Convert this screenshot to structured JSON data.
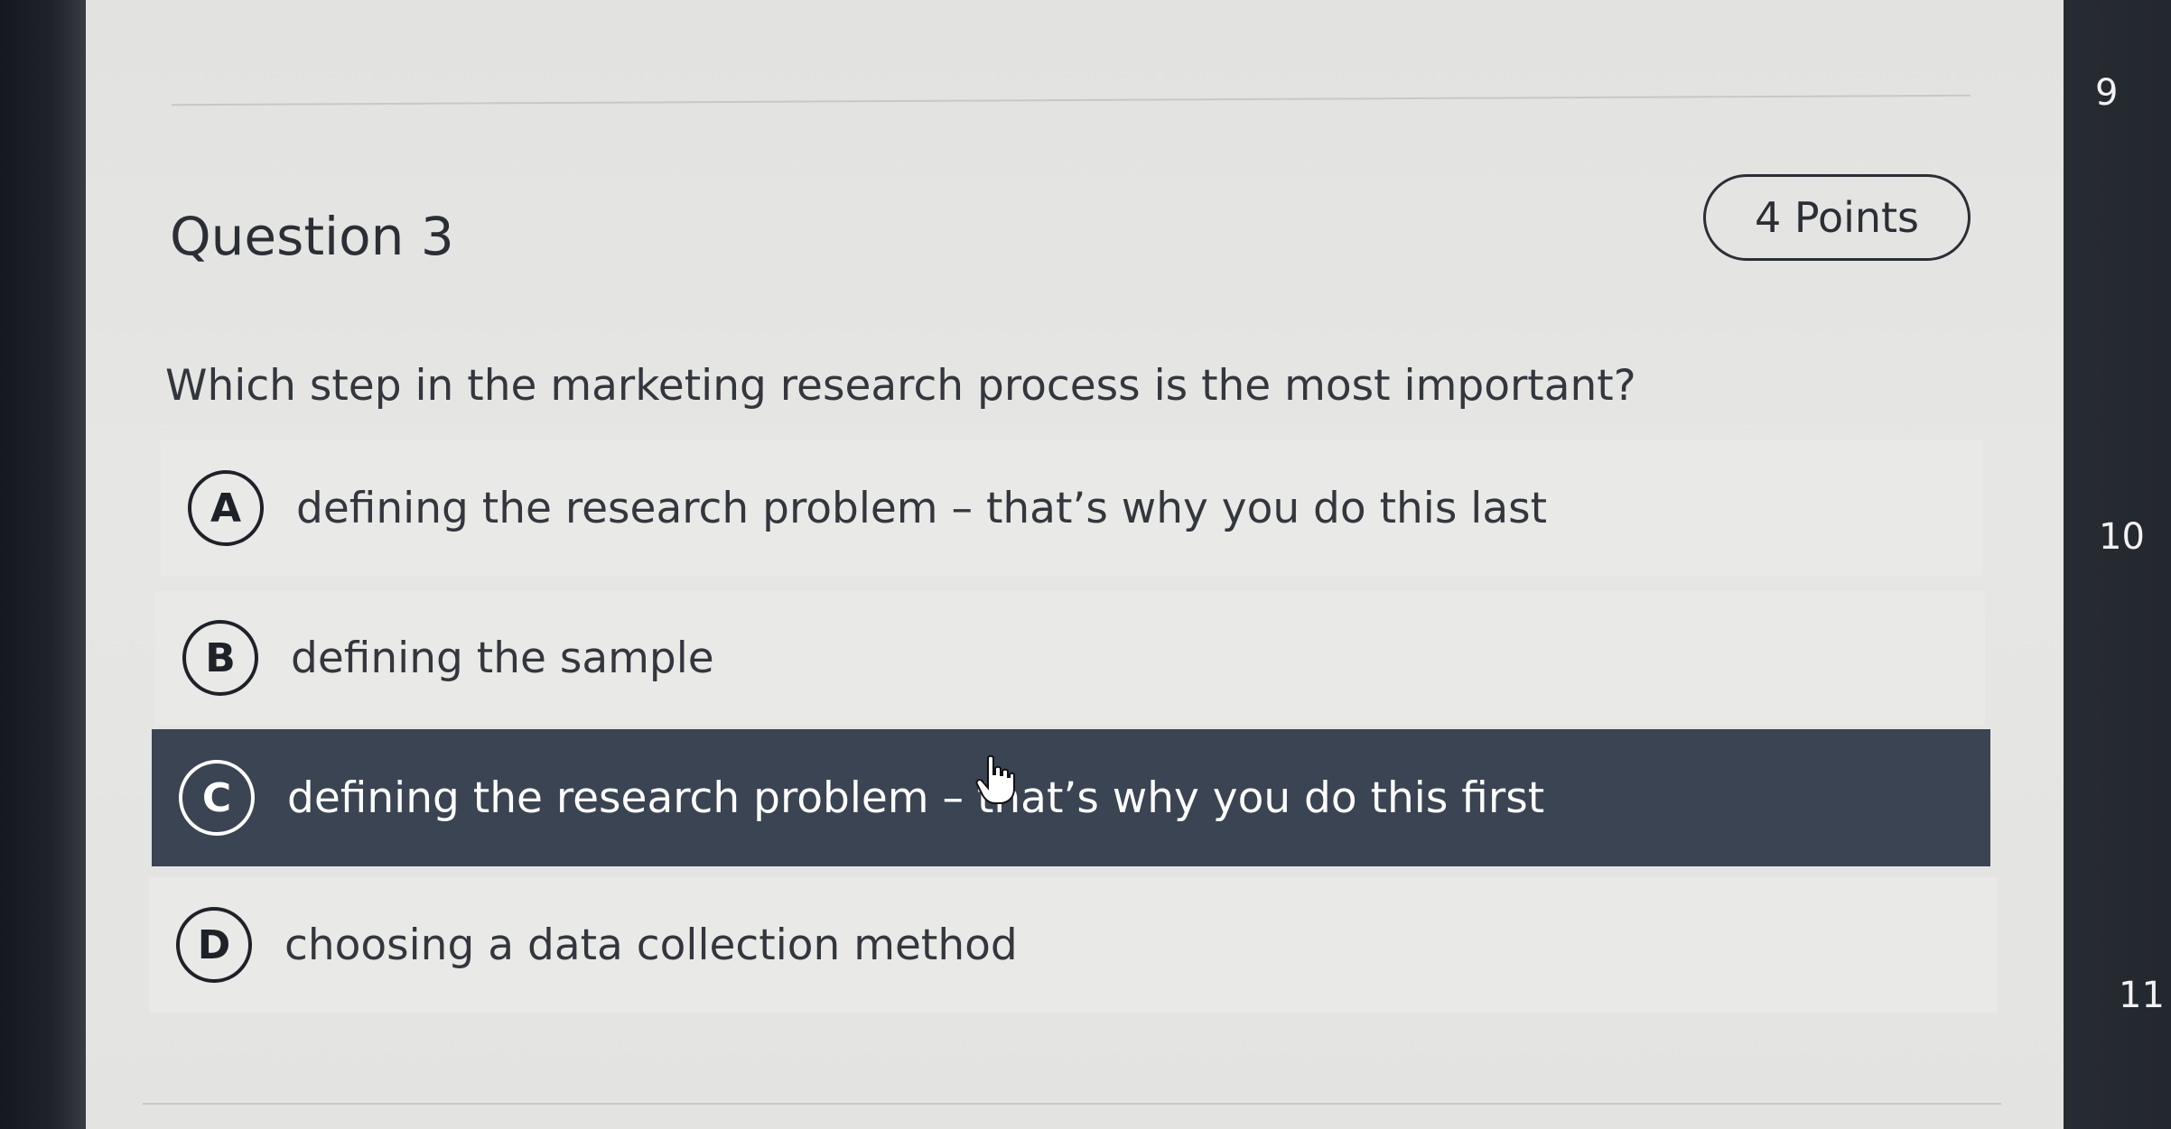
{
  "question": {
    "title": "Question 3",
    "points": "4 Points",
    "prompt": "Which step in the marketing research process is the most important?",
    "options": [
      {
        "letter": "A",
        "text": "defining the research problem – that’s why you do this last"
      },
      {
        "letter": "B",
        "text": "defining the sample"
      },
      {
        "letter": "C",
        "text": "defining the research problem – that’s why you do this first",
        "selected": true
      },
      {
        "letter": "D",
        "text": "choosing a data collection method"
      }
    ]
  },
  "nav": {
    "numbers": [
      "9",
      "10",
      "11"
    ]
  },
  "colors": {
    "selected_background": "#3a4452",
    "page_background": "#e4e4e2",
    "text": "#33373d"
  },
  "icons": {
    "cursor": "hand-pointer-icon"
  }
}
